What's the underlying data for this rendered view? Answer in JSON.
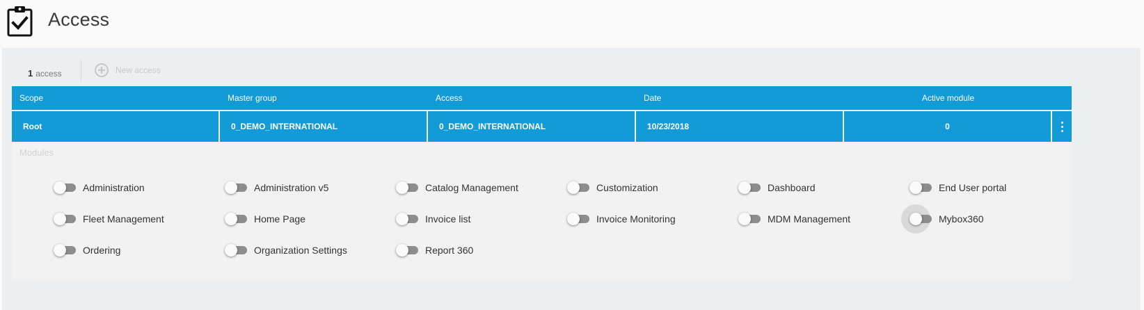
{
  "page": {
    "title": "Access",
    "icon": "clipboard-check-icon"
  },
  "toolbar": {
    "count": "1",
    "count_label": "access",
    "new_access_label": "New access"
  },
  "table": {
    "columns": [
      "Scope",
      "Master group",
      "Access",
      "Date",
      "Active module"
    ],
    "rows": [
      {
        "scope": "Root",
        "master_group": "0_DEMO_INTERNATIONAL",
        "access": "0_DEMO_INTERNATIONAL",
        "date": "10/23/2018",
        "active_module": "0"
      }
    ]
  },
  "modules": {
    "title": "Modules",
    "items": [
      {
        "label": "Administration",
        "on": false
      },
      {
        "label": "Administration v5",
        "on": false
      },
      {
        "label": "Catalog Management",
        "on": false
      },
      {
        "label": "Customization",
        "on": false
      },
      {
        "label": "Dashboard",
        "on": false
      },
      {
        "label": "End User portal",
        "on": false
      },
      {
        "label": "Fleet Management",
        "on": false
      },
      {
        "label": "Home Page",
        "on": false
      },
      {
        "label": "Invoice list",
        "on": false
      },
      {
        "label": "Invoice Monitoring",
        "on": false
      },
      {
        "label": "MDM Management",
        "on": false
      },
      {
        "label": "Mybox360",
        "on": false
      },
      {
        "label": "Ordering",
        "on": false
      },
      {
        "label": "Organization Settings",
        "on": false
      },
      {
        "label": "Report 360",
        "on": false
      }
    ]
  },
  "colors": {
    "header_blue": "#129bd6",
    "panel_bg": "#eceff1",
    "toggle_track_off": "#8d8d8d"
  }
}
